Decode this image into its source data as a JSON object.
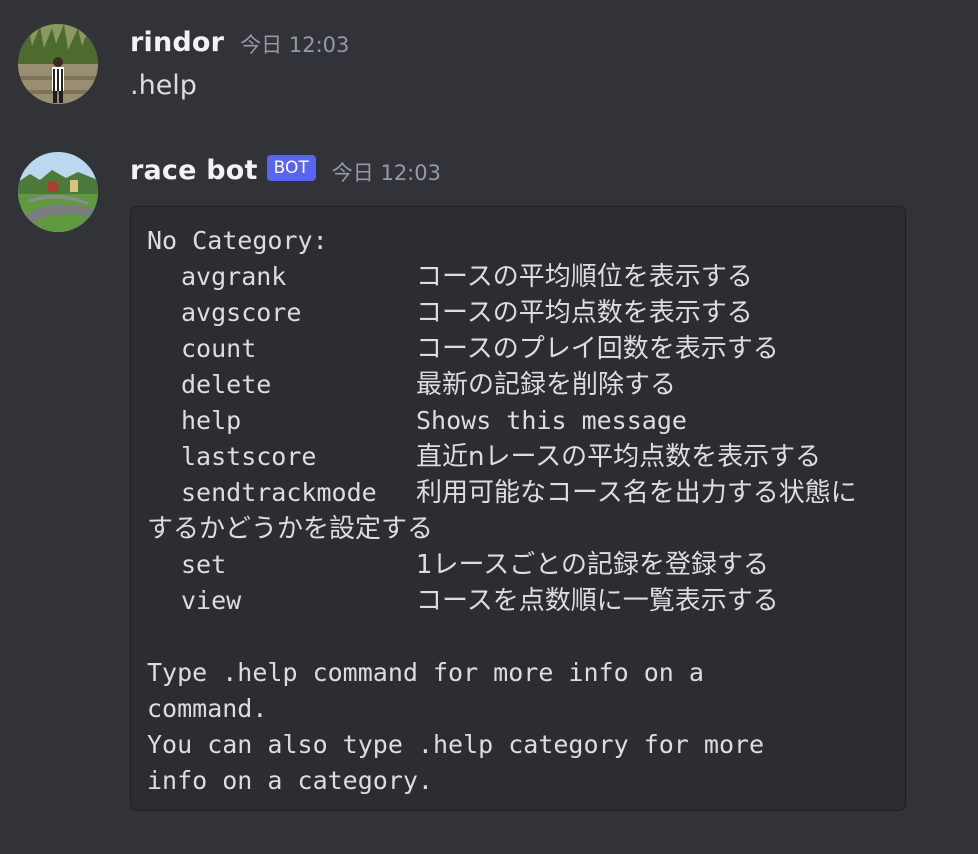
{
  "messages": [
    {
      "username": "rindor",
      "timestamp": "今日 12:03",
      "content": ".help",
      "avatar_icon": "user-photo-avatar"
    },
    {
      "username": "race bot",
      "bot_tag": "BOT",
      "timestamp": "今日 12:03",
      "avatar_icon": "racetrack-avatar",
      "codeblock": {
        "heading": "No Category:",
        "commands": [
          {
            "name": "avgrank",
            "description": "コースの平均順位を表示する"
          },
          {
            "name": "avgscore",
            "description": "コースの平均点数を表示する"
          },
          {
            "name": "count",
            "description": "コースのプレイ回数を表示する"
          },
          {
            "name": "delete",
            "description": "最新の記録を削除する"
          },
          {
            "name": "help",
            "description": "Shows this message"
          },
          {
            "name": "lastscore",
            "description": "直近nレースの平均点数を表示する"
          },
          {
            "name": "sendtrackmode",
            "description": "利用可能なコース名を出力する状態に",
            "description_wrap": "するかどうかを設定する"
          },
          {
            "name": "set",
            "description": "1レースごとの記録を登録する"
          },
          {
            "name": "view",
            "description": "コースを点数順に一覧表示する"
          }
        ],
        "footer": [
          "Type .help command for more info on a",
          "command.",
          "You can also type .help category for more",
          "info on a category."
        ]
      }
    }
  ],
  "colors": {
    "background": "#313338",
    "codeblock_bg": "#2b2d31",
    "bot_tag": "#5865f2",
    "username": "#f2f3f5",
    "timestamp": "#949ba4"
  }
}
